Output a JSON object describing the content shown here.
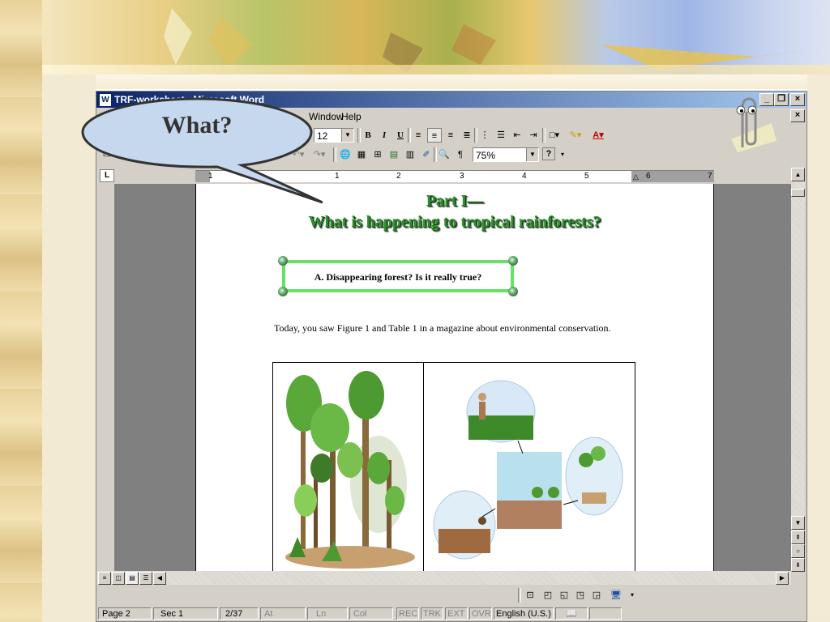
{
  "window": {
    "title": "TRF-worksheet - Microsoft Word",
    "icon_letter": "W"
  },
  "menu": {
    "window": "Window",
    "help": "Help"
  },
  "toolbar": {
    "font_size": "12",
    "bold": "B",
    "italic": "I",
    "underline": "U",
    "zoom": "75%",
    "pilcrow": "¶",
    "help_q": "?"
  },
  "ruler": {
    "corner": "L",
    "ticks": [
      "1",
      "1",
      "2",
      "3",
      "4",
      "5",
      "6",
      "7"
    ]
  },
  "document": {
    "part_title": "Part I—",
    "part_subtitle": "What is happening to tropical rainforests?",
    "frame_text": "A. Disappearing forest?    Is it really true?",
    "paragraph": "Today, you saw Figure 1 and Table 1 in a magazine about environmental conservation."
  },
  "callout": {
    "text": "What?"
  },
  "statusbar": {
    "page": "Page 2",
    "sec": "Sec 1",
    "count": "2/37",
    "at": "At",
    "ln": "Ln",
    "col": "Col",
    "rec": "REC",
    "trk": "TRK",
    "ext": "EXT",
    "ovr": "OVR",
    "language": "English (U.S.)"
  },
  "colors": {
    "titlebar_start": "#0a246a",
    "titlebar_end": "#a6caf0",
    "heading_green": "#2f8f2f",
    "frame_green": "#66e066",
    "chrome": "#d4d0c8"
  }
}
